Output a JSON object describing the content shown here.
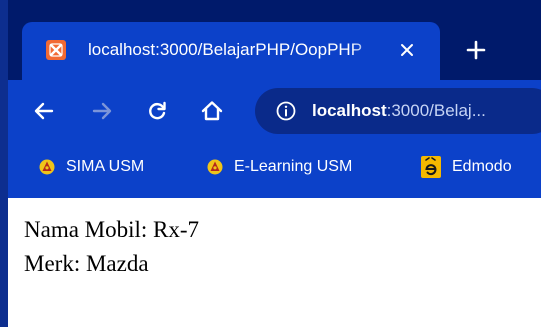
{
  "tab": {
    "title": "localhost:3000/BelajarPHP/OopPHP",
    "close_icon": "close-icon",
    "favicon_icon": "xampp-icon"
  },
  "toolbar": {
    "back_icon": "back-arrow-icon",
    "forward_icon": "forward-arrow-icon",
    "reload_icon": "reload-icon",
    "home_icon": "home-icon",
    "new_tab_icon": "plus-icon"
  },
  "omnibox": {
    "info_icon": "info-icon",
    "host": "localhost",
    "path": ":3000/Belaj..."
  },
  "bookmarks": [
    {
      "label": "SIMA USM",
      "icon": "usm-logo-icon"
    },
    {
      "label": "E-Learning USM",
      "icon": "usm-logo-icon"
    },
    {
      "label": "Edmodo",
      "icon": "edmodo-icon"
    }
  ],
  "page": {
    "line1": "Nama Mobil: Rx-7",
    "line2": "Merk: Mazda"
  },
  "colors": {
    "tab_strip": "#001a6b",
    "toolbar": "#0c41c9",
    "omnibox": "#0a2a8a",
    "favicon": "#f26a33",
    "edmodo": "#f5b800"
  }
}
